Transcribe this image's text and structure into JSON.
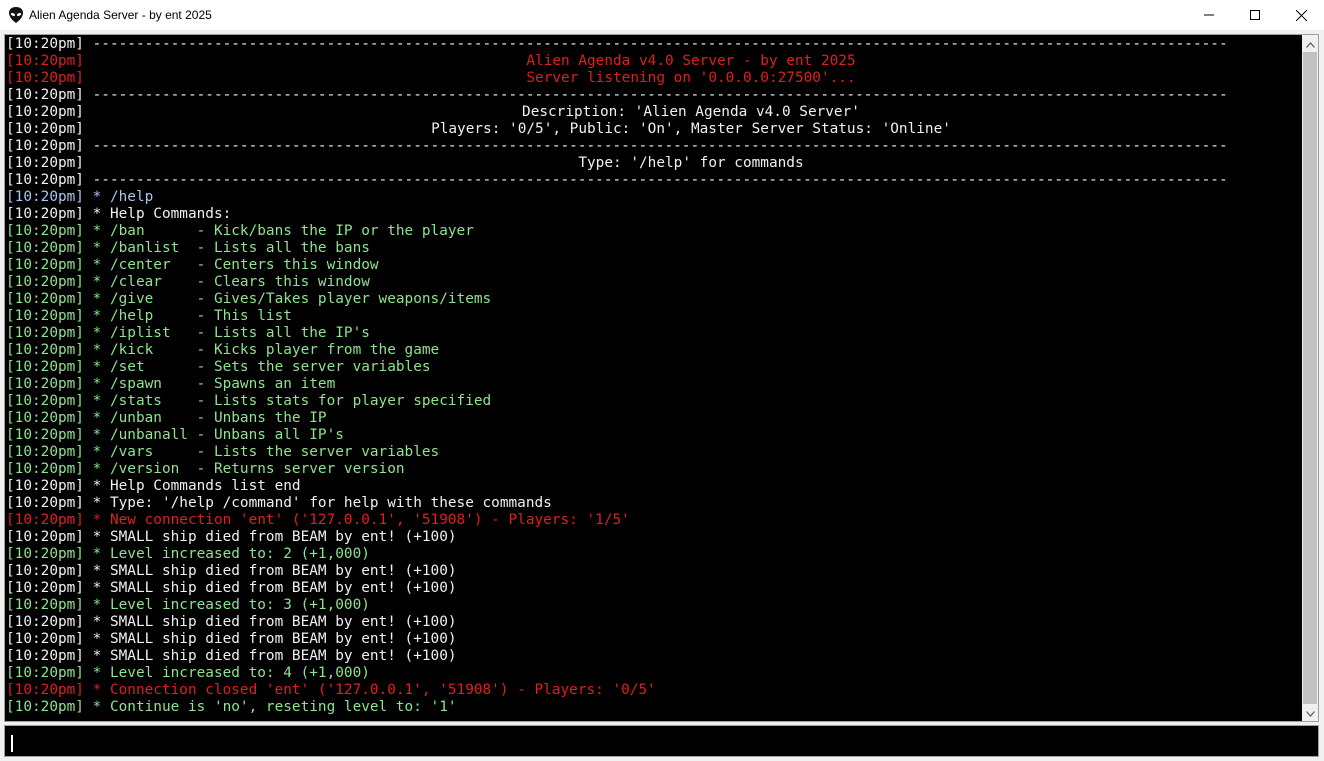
{
  "window": {
    "title": "Alien Agenda Server - by ent 2025",
    "app_icon": "alien-head-icon",
    "controls": [
      "minimize-icon",
      "maximize-icon",
      "close-icon"
    ]
  },
  "colors": {
    "background": "#000000",
    "text_white": "#f0f0f0",
    "text_red": "#e01f1f",
    "text_green": "#8fe28f",
    "text_blue": "#a9c6ef"
  },
  "console": {
    "lines": [
      {
        "ts": "[10:20pm]",
        "ts_color": "white",
        "msg": " -----------------------------------------------------------------------------------------------------------------------------------",
        "msg_color": "white",
        "align": "left",
        "kind": "separator"
      },
      {
        "ts": "[10:20pm]",
        "ts_color": "red",
        "msg": "Alien Agenda v4.0 Server - by ent 2025",
        "msg_color": "red",
        "align": "center",
        "kind": "banner"
      },
      {
        "ts": "[10:20pm]",
        "ts_color": "red",
        "msg": "Server listening on '0.0.0.0:27500'...",
        "msg_color": "red",
        "align": "center",
        "kind": "banner"
      },
      {
        "ts": "[10:20pm]",
        "ts_color": "white",
        "msg": " -----------------------------------------------------------------------------------------------------------------------------------",
        "msg_color": "white",
        "align": "left",
        "kind": "separator"
      },
      {
        "ts": "[10:20pm]",
        "ts_color": "white",
        "msg": "Description: 'Alien Agenda v4.0 Server'",
        "msg_color": "white",
        "align": "center",
        "kind": "info"
      },
      {
        "ts": "[10:20pm]",
        "ts_color": "white",
        "msg": "Players: '0/5', Public: 'On', Master Server Status: 'Online'",
        "msg_color": "white",
        "align": "center",
        "kind": "info"
      },
      {
        "ts": "[10:20pm]",
        "ts_color": "white",
        "msg": " -----------------------------------------------------------------------------------------------------------------------------------",
        "msg_color": "white",
        "align": "left",
        "kind": "separator"
      },
      {
        "ts": "[10:20pm]",
        "ts_color": "white",
        "msg": "Type: '/help' for commands",
        "msg_color": "white",
        "align": "center",
        "kind": "info"
      },
      {
        "ts": "[10:20pm]",
        "ts_color": "white",
        "msg": " -----------------------------------------------------------------------------------------------------------------------------------",
        "msg_color": "white",
        "align": "left",
        "kind": "separator"
      },
      {
        "ts": "[10:20pm]",
        "ts_color": "blue",
        "msg": " * /help",
        "msg_color": "blue",
        "align": "left",
        "kind": "command"
      },
      {
        "ts": "[10:20pm]",
        "ts_color": "white",
        "msg": " * Help Commands:",
        "msg_color": "white",
        "align": "left",
        "kind": "log"
      },
      {
        "ts": "[10:20pm]",
        "ts_color": "green",
        "msg": " * /ban      - Kick/bans the IP or the player",
        "msg_color": "green",
        "align": "left",
        "kind": "help"
      },
      {
        "ts": "[10:20pm]",
        "ts_color": "green",
        "msg": " * /banlist  - Lists all the bans",
        "msg_color": "green",
        "align": "left",
        "kind": "help"
      },
      {
        "ts": "[10:20pm]",
        "ts_color": "green",
        "msg": " * /center   - Centers this window",
        "msg_color": "green",
        "align": "left",
        "kind": "help"
      },
      {
        "ts": "[10:20pm]",
        "ts_color": "green",
        "msg": " * /clear    - Clears this window",
        "msg_color": "green",
        "align": "left",
        "kind": "help"
      },
      {
        "ts": "[10:20pm]",
        "ts_color": "green",
        "msg": " * /give     - Gives/Takes player weapons/items",
        "msg_color": "green",
        "align": "left",
        "kind": "help"
      },
      {
        "ts": "[10:20pm]",
        "ts_color": "green",
        "msg": " * /help     - This list",
        "msg_color": "green",
        "align": "left",
        "kind": "help"
      },
      {
        "ts": "[10:20pm]",
        "ts_color": "green",
        "msg": " * /iplist   - Lists all the IP's",
        "msg_color": "green",
        "align": "left",
        "kind": "help"
      },
      {
        "ts": "[10:20pm]",
        "ts_color": "green",
        "msg": " * /kick     - Kicks player from the game",
        "msg_color": "green",
        "align": "left",
        "kind": "help"
      },
      {
        "ts": "[10:20pm]",
        "ts_color": "green",
        "msg": " * /set      - Sets the server variables",
        "msg_color": "green",
        "align": "left",
        "kind": "help"
      },
      {
        "ts": "[10:20pm]",
        "ts_color": "green",
        "msg": " * /spawn    - Spawns an item",
        "msg_color": "green",
        "align": "left",
        "kind": "help"
      },
      {
        "ts": "[10:20pm]",
        "ts_color": "green",
        "msg": " * /stats    - Lists stats for player specified",
        "msg_color": "green",
        "align": "left",
        "kind": "help"
      },
      {
        "ts": "[10:20pm]",
        "ts_color": "green",
        "msg": " * /unban    - Unbans the IP",
        "msg_color": "green",
        "align": "left",
        "kind": "help"
      },
      {
        "ts": "[10:20pm]",
        "ts_color": "green",
        "msg": " * /unbanall - Unbans all IP's",
        "msg_color": "green",
        "align": "left",
        "kind": "help"
      },
      {
        "ts": "[10:20pm]",
        "ts_color": "green",
        "msg": " * /vars     - Lists the server variables",
        "msg_color": "green",
        "align": "left",
        "kind": "help"
      },
      {
        "ts": "[10:20pm]",
        "ts_color": "green",
        "msg": " * /version  - Returns server version",
        "msg_color": "green",
        "align": "left",
        "kind": "help"
      },
      {
        "ts": "[10:20pm]",
        "ts_color": "white",
        "msg": " * Help Commands list end",
        "msg_color": "white",
        "align": "left",
        "kind": "log"
      },
      {
        "ts": "[10:20pm]",
        "ts_color": "white",
        "msg": " * Type: '/help /command' for help with these commands",
        "msg_color": "white",
        "align": "left",
        "kind": "log"
      },
      {
        "ts": "[10:20pm]",
        "ts_color": "red",
        "msg": " * New connection 'ent' ('127.0.0.1', '51908') - Players: '1/5'",
        "msg_color": "red",
        "align": "left",
        "kind": "connection"
      },
      {
        "ts": "[10:20pm]",
        "ts_color": "white",
        "msg": " * SMALL ship died from BEAM by ent! (+100)",
        "msg_color": "white",
        "align": "left",
        "kind": "log"
      },
      {
        "ts": "[10:20pm]",
        "ts_color": "green",
        "msg": " * Level increased to: 2 (+1,000)",
        "msg_color": "green",
        "align": "left",
        "kind": "level"
      },
      {
        "ts": "[10:20pm]",
        "ts_color": "white",
        "msg": " * SMALL ship died from BEAM by ent! (+100)",
        "msg_color": "white",
        "align": "left",
        "kind": "log"
      },
      {
        "ts": "[10:20pm]",
        "ts_color": "white",
        "msg": " * SMALL ship died from BEAM by ent! (+100)",
        "msg_color": "white",
        "align": "left",
        "kind": "log"
      },
      {
        "ts": "[10:20pm]",
        "ts_color": "green",
        "msg": " * Level increased to: 3 (+1,000)",
        "msg_color": "green",
        "align": "left",
        "kind": "level"
      },
      {
        "ts": "[10:20pm]",
        "ts_color": "white",
        "msg": " * SMALL ship died from BEAM by ent! (+100)",
        "msg_color": "white",
        "align": "left",
        "kind": "log"
      },
      {
        "ts": "[10:20pm]",
        "ts_color": "white",
        "msg": " * SMALL ship died from BEAM by ent! (+100)",
        "msg_color": "white",
        "align": "left",
        "kind": "log"
      },
      {
        "ts": "[10:20pm]",
        "ts_color": "white",
        "msg": " * SMALL ship died from BEAM by ent! (+100)",
        "msg_color": "white",
        "align": "left",
        "kind": "log"
      },
      {
        "ts": "[10:20pm]",
        "ts_color": "green",
        "msg": " * Level increased to: 4 (+1,000)",
        "msg_color": "green",
        "align": "left",
        "kind": "level"
      },
      {
        "ts": "[10:20pm]",
        "ts_color": "red",
        "msg": " * Connection closed 'ent' ('127.0.0.1', '51908') - Players: '0/5'",
        "msg_color": "red",
        "align": "left",
        "kind": "connection"
      },
      {
        "ts": "[10:20pm]",
        "ts_color": "green",
        "msg": " * Continue is 'no', reseting level to: '1'",
        "msg_color": "green",
        "align": "left",
        "kind": "level"
      }
    ]
  },
  "input": {
    "value": "",
    "placeholder": ""
  }
}
